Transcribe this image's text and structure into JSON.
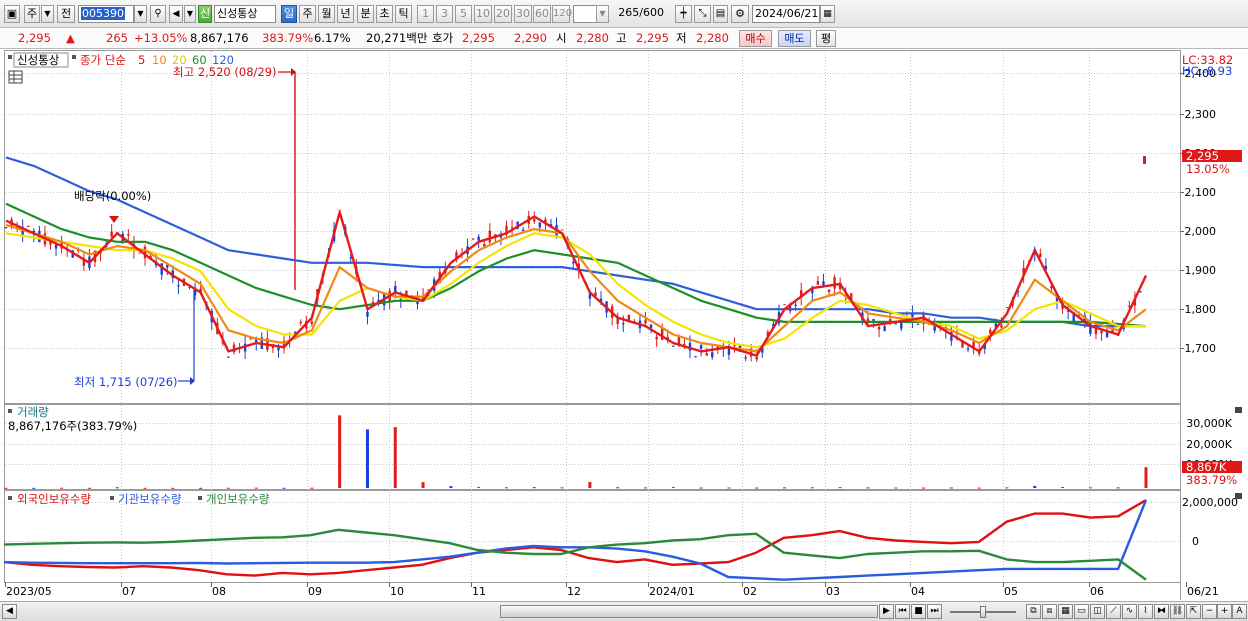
{
  "toolbar": {
    "period_label": "주",
    "prev_label": "전",
    "stock_code": "005390",
    "badge_label": "신",
    "stock_name": "신성통상",
    "intervals": [
      "일",
      "주",
      "월",
      "년",
      "분",
      "초",
      "틱"
    ],
    "selected_interval": "일",
    "quick_counts": [
      "1",
      "3",
      "5",
      "10",
      "20",
      "30",
      "60",
      "120"
    ],
    "display_count": "265",
    "total_count": "/600",
    "date": "2024/06/21"
  },
  "quote": {
    "price": "2,295",
    "arrow": "▲",
    "change": "265",
    "change_pct": "+13.05%",
    "volume": "8,867,176",
    "volume_ratio": "383.79%",
    "turnover": "6.17%",
    "amount": "20,271백만",
    "hoga_label": "호가",
    "ask": "2,295",
    "bid": "2,290",
    "open_label": "시",
    "open": "2,280",
    "high_label": "고",
    "high": "2,295",
    "low_label": "저",
    "low": "2,280",
    "buy_label": "매수",
    "sell_label": "매도",
    "eval_label": "평"
  },
  "price_pane": {
    "legend_stock": "신성통상",
    "legend_close": "종가 단순",
    "ma_periods": [
      "5",
      "10",
      "20",
      "60",
      "120"
    ],
    "high_annotation": "최고 2,520 (08/29)",
    "low_annotation": "최저 1,715 (07/26)",
    "dividend_annotation": "배당락(0.00%)",
    "lc_label": "LC:33.82",
    "hc_label": "HC:-8.93",
    "current_tag": "2,295",
    "current_pct": "13.05%"
  },
  "volume_pane": {
    "title": "거래량",
    "value": "8,867,176주(383.79%)",
    "current_tag": "8,867K",
    "current_pct": "383.79%"
  },
  "holding_pane": {
    "legend": [
      "외국인보유수량",
      "기관보유수량",
      "개인보유수량"
    ]
  },
  "colors": {
    "ma5": "#e31b1b",
    "ma10": "#f08a12",
    "ma20": "#f5e400",
    "ma60": "#1a8f2a",
    "ma120": "#2f5fd8",
    "up": "#e31b1b",
    "down": "#1a3fd8",
    "foreign": "#e01010",
    "institution": "#2a5ce0",
    "individual": "#2a8a3a"
  },
  "chart_data": [
    {
      "type": "line",
      "pane": "price",
      "y_ticks": [
        "2,400",
        "2,300",
        "2,200",
        "2,100",
        "2,000",
        "1,900",
        "1,800",
        "1,700"
      ],
      "ylim": [
        1680,
        2510
      ],
      "x_labels": [
        "2023/05",
        "07",
        "08",
        "09",
        "10",
        "11",
        "12",
        "2024/01",
        "02",
        "03",
        "04",
        "05",
        "06",
        "06/21"
      ],
      "series": [
        {
          "name": "5",
          "values": [
            2110,
            2080,
            2050,
            2010,
            2080,
            2030,
            1980,
            1940,
            1800,
            1820,
            1810,
            1880,
            2130,
            1900,
            1940,
            1920,
            2010,
            2060,
            2080,
            2120,
            2080,
            1940,
            1880,
            1860,
            1820,
            1800,
            1810,
            1790,
            1900,
            1950,
            1960,
            1860,
            1870,
            1880,
            1840,
            1800,
            1890,
            2040,
            1910,
            1860,
            1840,
            1980
          ]
        },
        {
          "name": "10",
          "values": [
            2100,
            2080,
            2060,
            2030,
            2050,
            2040,
            2000,
            1960,
            1850,
            1830,
            1820,
            1850,
            2000,
            1950,
            1930,
            1930,
            1990,
            2040,
            2070,
            2090,
            2080,
            1990,
            1920,
            1880,
            1840,
            1820,
            1810,
            1800,
            1860,
            1920,
            1940,
            1890,
            1880,
            1870,
            1850,
            1820,
            1860,
            1970,
            1920,
            1870,
            1850,
            1900
          ]
        },
        {
          "name": "20",
          "values": [
            2080,
            2070,
            2060,
            2050,
            2040,
            2040,
            2020,
            1990,
            1900,
            1860,
            1840,
            1840,
            1920,
            1950,
            1930,
            1920,
            1960,
            2010,
            2050,
            2080,
            2070,
            2030,
            1960,
            1910,
            1870,
            1840,
            1820,
            1810,
            1830,
            1880,
            1920,
            1910,
            1890,
            1870,
            1860,
            1830,
            1850,
            1900,
            1920,
            1890,
            1860,
            1860
          ]
        },
        {
          "name": "60",
          "values": [
            2150,
            2120,
            2090,
            2070,
            2060,
            2060,
            2040,
            2010,
            1980,
            1950,
            1930,
            1910,
            1900,
            1910,
            1920,
            1920,
            1950,
            1990,
            2020,
            2040,
            2030,
            2020,
            2010,
            1980,
            1950,
            1920,
            1900,
            1880,
            1870,
            1870,
            1870,
            1870,
            1870,
            1870,
            1870,
            1870,
            1870,
            1870,
            1870,
            1870,
            1865,
            1860
          ]
        },
        {
          "name": "120",
          "values": [
            2260,
            2240,
            2210,
            2180,
            2160,
            2130,
            2100,
            2070,
            2040,
            2030,
            2020,
            2010,
            2010,
            2010,
            2005,
            2000,
            2000,
            2000,
            2000,
            2000,
            2000,
            1990,
            1980,
            1970,
            1960,
            1940,
            1920,
            1900,
            1900,
            1900,
            1900,
            1900,
            1890,
            1890,
            1880,
            1880,
            1870,
            1870,
            1870,
            1860,
            1860,
            1860
          ]
        }
      ]
    },
    {
      "type": "bar",
      "pane": "volume",
      "y_ticks": [
        "30,000K",
        "20,000K",
        "10,000K"
      ],
      "ylim": [
        0,
        35000
      ],
      "values": [
        80,
        60,
        120,
        90,
        300,
        70,
        60,
        80,
        120,
        150,
        90,
        120,
        31000,
        25000,
        26000,
        2500,
        800,
        400,
        300,
        350,
        280,
        2600,
        300,
        250,
        400,
        200,
        220,
        180,
        250,
        300,
        350,
        240,
        200,
        180,
        220,
        160,
        260,
        900,
        420,
        280,
        260,
        8867
      ]
    },
    {
      "type": "line",
      "pane": "holding",
      "y_ticks": [
        "2,000,000",
        "0"
      ],
      "ylim": [
        -1000000,
        2300000
      ],
      "series": [
        {
          "name": "외국인보유수량",
          "values": [
            -300000,
            -400000,
            -450000,
            -480000,
            -500000,
            -450000,
            -500000,
            -600000,
            -750000,
            -800000,
            -700000,
            -750000,
            -700000,
            -600000,
            -500000,
            -400000,
            -150000,
            50000,
            150000,
            250000,
            150000,
            -150000,
            -300000,
            -200000,
            -400000,
            -350000,
            -300000,
            50000,
            600000,
            700000,
            850000,
            600000,
            500000,
            450000,
            400000,
            450000,
            1200000,
            1500000,
            1500000,
            1350000,
            1400000,
            2000000
          ]
        },
        {
          "name": "기관보유수량",
          "values": [
            -300000,
            -320000,
            -330000,
            -340000,
            -340000,
            -340000,
            -340000,
            -330000,
            -350000,
            -340000,
            -330000,
            -320000,
            -320000,
            -320000,
            -300000,
            -200000,
            -100000,
            50000,
            200000,
            300000,
            250000,
            250000,
            200000,
            100000,
            -100000,
            -350000,
            -850000,
            -900000,
            -950000,
            -900000,
            -850000,
            -800000,
            -750000,
            -700000,
            -650000,
            -600000,
            -550000,
            -550000,
            -550000,
            -550000,
            -550000,
            2000000
          ]
        },
        {
          "name": "개인보유수량",
          "values": [
            350000,
            380000,
            400000,
            420000,
            430000,
            420000,
            450000,
            500000,
            550000,
            600000,
            620000,
            700000,
            900000,
            800000,
            700000,
            550000,
            400000,
            150000,
            50000,
            0,
            0,
            250000,
            350000,
            400000,
            500000,
            550000,
            700000,
            750000,
            50000,
            -50000,
            -150000,
            0,
            50000,
            100000,
            100000,
            120000,
            -200000,
            -300000,
            -300000,
            -250000,
            -200000,
            -950000
          ]
        }
      ]
    }
  ]
}
